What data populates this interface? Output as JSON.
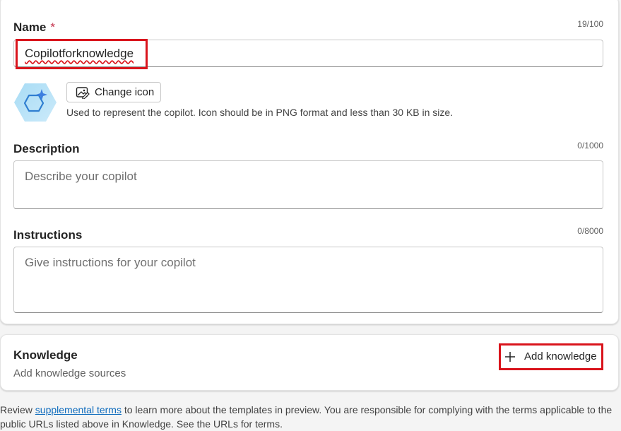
{
  "name": {
    "label": "Name",
    "required_mark": "*",
    "counter": "19/100",
    "value": "Copilotforknowledge"
  },
  "icon": {
    "change_label": "Change icon",
    "helper": "Used to represent the copilot. Icon should be in PNG format and less than 30 KB in size."
  },
  "description": {
    "label": "Description",
    "counter": "0/1000",
    "placeholder": "Describe your copilot"
  },
  "instructions": {
    "label": "Instructions",
    "counter": "0/8000",
    "placeholder": "Give instructions for your copilot"
  },
  "knowledge": {
    "title": "Knowledge",
    "subtitle": "Add knowledge sources",
    "add_label": "Add knowledge"
  },
  "footer": {
    "prefix": "Review ",
    "link": "supplemental terms",
    "suffix": " to learn more about the templates in preview. You are responsible for complying with the terms applicable to the public URLs listed above in Knowledge. See the URLs for terms."
  },
  "colors": {
    "highlight": "#d9141c",
    "link": "#0f6cbd",
    "required": "#c4314b"
  }
}
